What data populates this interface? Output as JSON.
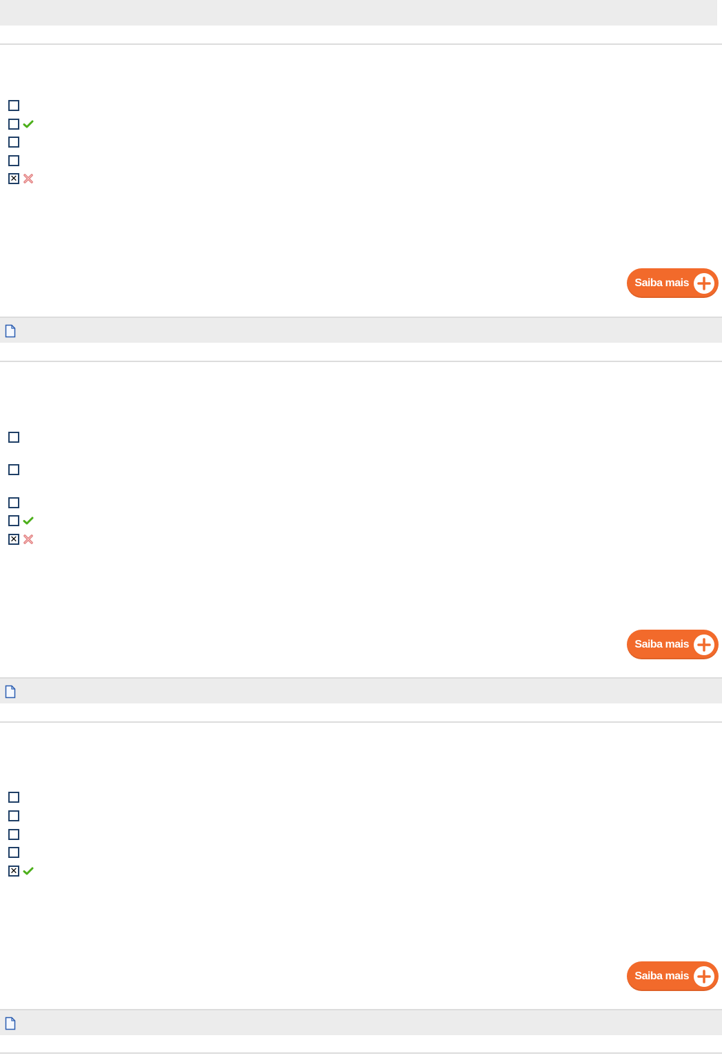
{
  "questions": [
    {
      "options": [
        {
          "checked": false,
          "mark": "none",
          "mark_icon": ""
        },
        {
          "checked": false,
          "mark": "correct",
          "mark_icon": "check-icon"
        },
        {
          "checked": false,
          "mark": "none",
          "mark_icon": ""
        },
        {
          "checked": false,
          "mark": "none",
          "mark_icon": ""
        },
        {
          "checked": true,
          "mark": "wrong",
          "mark_icon": "cross-icon"
        }
      ],
      "saiba_label": "Saiba mais",
      "footer_icon": "document-icon"
    },
    {
      "options": [
        {
          "checked": false,
          "mark": "none",
          "mark_icon": ""
        },
        {
          "checked": false,
          "mark": "none",
          "mark_icon": ""
        },
        {
          "checked": false,
          "mark": "none",
          "mark_icon": ""
        },
        {
          "checked": false,
          "mark": "correct",
          "mark_icon": "check-icon"
        },
        {
          "checked": true,
          "mark": "wrong",
          "mark_icon": "cross-icon"
        }
      ],
      "saiba_label": "Saiba mais",
      "footer_icon": "document-icon"
    },
    {
      "options": [
        {
          "checked": false,
          "mark": "none",
          "mark_icon": ""
        },
        {
          "checked": false,
          "mark": "none",
          "mark_icon": ""
        },
        {
          "checked": false,
          "mark": "none",
          "mark_icon": ""
        },
        {
          "checked": false,
          "mark": "none",
          "mark_icon": ""
        },
        {
          "checked": true,
          "mark": "correct",
          "mark_icon": "check-icon"
        }
      ],
      "saiba_label": "Saiba mais",
      "footer_icon": "document-icon"
    }
  ],
  "colors": {
    "accent": "#f26a2b",
    "checkbox_border": "#1f3f66",
    "correct": "#4caf1a",
    "wrong": "#d9534f",
    "bar_background": "#ececec"
  }
}
